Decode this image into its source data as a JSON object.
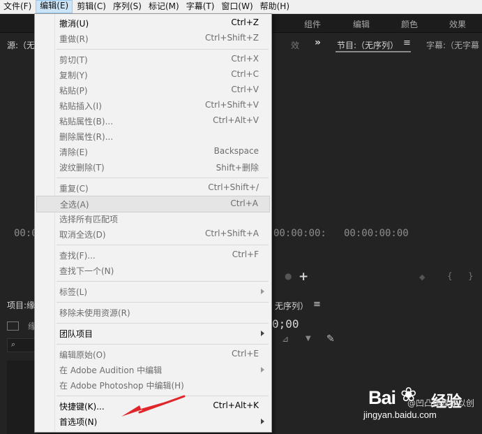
{
  "menubar": {
    "items": [
      "文件(F)",
      "编辑(E)",
      "剪辑(C)",
      "序列(S)",
      "标记(M)",
      "字幕(T)",
      "窗口(W)",
      "帮助(H)"
    ],
    "active": "编辑(E)"
  },
  "workspace_tabs": [
    "组件",
    "编辑",
    "颜色",
    "效果"
  ],
  "panels": {
    "source_title": "源:（无",
    "source_timecode": "00:0",
    "middle_timecode": "00:00:00:",
    "middle_tab_fragment": "效",
    "program_title": "节目:（无序列）",
    "captions_title": "字幕:（无字幕",
    "program_timecode": "00:00:00:00",
    "project_title": "项目:缘",
    "project_sub": "缘",
    "timeline_title": "无序列）",
    "timeline_timecode": "0;00"
  },
  "edit_menu": {
    "items": [
      {
        "label": "撤消(U)",
        "shortcut": "Ctrl+Z",
        "enabled": true
      },
      {
        "label": "重做(R)",
        "shortcut": "Ctrl+Shift+Z",
        "enabled": false
      },
      {
        "label": "剪切(T)",
        "shortcut": "Ctrl+X",
        "enabled": false
      },
      {
        "label": "复制(Y)",
        "shortcut": "Ctrl+C",
        "enabled": false
      },
      {
        "label": "粘贴(P)",
        "shortcut": "Ctrl+V",
        "enabled": false
      },
      {
        "label": "粘贴插入(I)",
        "shortcut": "Ctrl+Shift+V",
        "enabled": false
      },
      {
        "label": "粘贴属性(B)...",
        "shortcut": "Ctrl+Alt+V",
        "enabled": false
      },
      {
        "label": "删除属性(R)...",
        "shortcut": "",
        "enabled": false
      },
      {
        "label": "清除(E)",
        "shortcut": "Backspace",
        "enabled": false
      },
      {
        "label": "波纹删除(T)",
        "shortcut": "Shift+删除",
        "enabled": false
      },
      {
        "label": "重复(C)",
        "shortcut": "Ctrl+Shift+/",
        "enabled": false
      },
      {
        "label": "全选(A)",
        "shortcut": "Ctrl+A",
        "enabled": false,
        "highlighted": true
      },
      {
        "label": "选择所有匹配项",
        "shortcut": "",
        "enabled": false
      },
      {
        "label": "取消全选(D)",
        "shortcut": "Ctrl+Shift+A",
        "enabled": false
      },
      {
        "label": "查找(F)...",
        "shortcut": "Ctrl+F",
        "enabled": false
      },
      {
        "label": "查找下一个(N)",
        "shortcut": "",
        "enabled": false
      },
      {
        "label": "标签(L)",
        "shortcut": "",
        "enabled": false,
        "submenu": true
      },
      {
        "label": "移除未使用资源(R)",
        "shortcut": "",
        "enabled": false
      },
      {
        "label": "团队项目",
        "shortcut": "",
        "enabled": true,
        "submenu": true
      },
      {
        "label": "编辑原始(O)",
        "shortcut": "Ctrl+E",
        "enabled": false
      },
      {
        "label": "在 Adobe Audition 中编辑",
        "shortcut": "",
        "enabled": false,
        "submenu": true
      },
      {
        "label": "在 Adobe Photoshop 中编辑(H)",
        "shortcut": "",
        "enabled": false
      },
      {
        "label": "快捷键(K)...",
        "shortcut": "Ctrl+Alt+K",
        "enabled": true
      },
      {
        "label": "首选项(N)",
        "shortcut": "",
        "enabled": true,
        "submenu": true
      }
    ]
  },
  "watermark": {
    "logo": "Bai",
    "logo2": "经验",
    "url": "jingyan.baidu.com",
    "overlap_text": "@凹凸体媒体以创"
  },
  "colors": {
    "menu_bg": "#f2f2f2",
    "panel_bg": "#232323",
    "arrow": "#e0262b",
    "highlight": "#e5e5e5"
  }
}
